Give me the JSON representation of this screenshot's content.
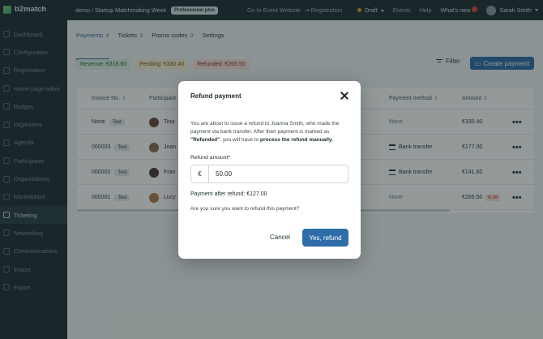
{
  "app": {
    "logo_text": "b2match"
  },
  "sidebar": {
    "items": [
      {
        "label": "Dashboard",
        "active": false
      },
      {
        "label": "Configuration",
        "active": false
      },
      {
        "label": "Registration",
        "active": false
      },
      {
        "label": "Home page editor",
        "active": false
      },
      {
        "label": "Badges",
        "active": false
      },
      {
        "label": "Organizers",
        "active": false
      },
      {
        "label": "Agenda",
        "active": false
      },
      {
        "label": "Participants",
        "active": false
      },
      {
        "label": "Organizations",
        "active": false
      },
      {
        "label": "Marketplace",
        "active": false
      },
      {
        "label": "Ticketing",
        "active": true
      },
      {
        "label": "Networking",
        "active": false
      },
      {
        "label": "Communications",
        "active": false
      },
      {
        "label": "Import",
        "active": false
      },
      {
        "label": "Export",
        "active": false
      }
    ]
  },
  "topbar": {
    "breadcrumb": "demo / Startup Matchmaking Week",
    "plan_badge": "Professional plus",
    "go_to_event": "Go to Event Website",
    "registration": "Registration",
    "draft": "Draft",
    "events": "Events",
    "help": "Help",
    "whats_new": "What's new",
    "whats_new_count": "",
    "user_name": "Sarah Smith",
    "colors": {
      "draft_dot": "#e0a528",
      "badge": "#e0443a"
    }
  },
  "tabs": [
    {
      "label": "Payments",
      "count": "4",
      "active": true
    },
    {
      "label": "Tickets",
      "count": "3",
      "active": false
    },
    {
      "label": "Promo codes",
      "count": "3",
      "active": false
    },
    {
      "label": "Settings",
      "count": "",
      "active": false
    }
  ],
  "summary": {
    "revenue": "Revenue: €318.60",
    "pending": "Pending: €330.40",
    "refunded": "Refunded: €265.50"
  },
  "toolbar": {
    "filter_label": "Filter",
    "create_label": "Create payment"
  },
  "table": {
    "headers": {
      "invoice": "Invoice No.",
      "participant": "Participant",
      "method": "Payment method",
      "amount": "Amount"
    },
    "rows": [
      {
        "invoice": "None",
        "tag": "Test",
        "participant": "Tina",
        "method": "None",
        "amount": "€330.40",
        "extra": "",
        "bank": false
      },
      {
        "invoice": "000003",
        "tag": "Test",
        "participant": "Joan",
        "method": "Bank transfer",
        "amount": "€177.00",
        "extra": "",
        "bank": true
      },
      {
        "invoice": "000002",
        "tag": "Test",
        "participant": "Fran",
        "method": "Bank transfer",
        "amount": "€141.60",
        "extra": "",
        "bank": true
      },
      {
        "invoice": "000001",
        "tag": "Test",
        "participant": "Lucy",
        "method": "None",
        "amount": "€265.50",
        "extra": "€-26",
        "bank": false
      }
    ],
    "more_icon": "more-horizontal-icon"
  },
  "modal": {
    "title": "Refund payment",
    "desc_1": "You are about to issue a refund to Joanna Smith, who made the payment via bank transfer. After their payment is marked as ",
    "desc_bold_1": "\"Refunded\"",
    "desc_2": ", you will have to ",
    "desc_bold_2": "process the refund manually.",
    "amount_label": "Refund amount*",
    "currency": "€",
    "amount_value": "50.00",
    "after_refund": "Payment after refund: €127.00",
    "confirm_question": "Are you sure you want to refund this payment?",
    "cancel_label": "Cancel",
    "confirm_label": "Yes, refund",
    "colors": {
      "primary": "#2e6da8"
    }
  }
}
